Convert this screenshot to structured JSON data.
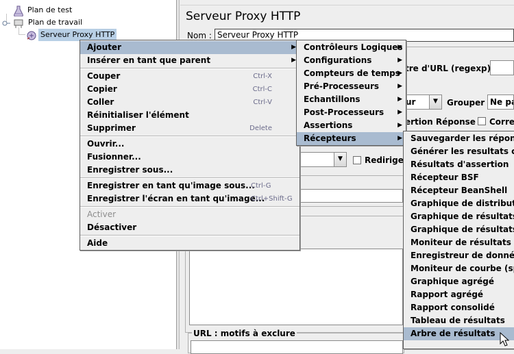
{
  "tree": {
    "items": [
      {
        "label": "Plan de test",
        "icon": "flask-icon"
      },
      {
        "label": "Plan de travail",
        "icon": "workbench-icon"
      },
      {
        "label": "Serveur Proxy HTTP",
        "icon": "proxy-icon"
      }
    ]
  },
  "panel": {
    "title": "Serveur Proxy HTTP",
    "name_label": "Nom :",
    "name_value": "Serveur Proxy HTTP",
    "url_regex_label": "tre d'URL (regexp) :",
    "group_combo_value": "ur",
    "group_label": "Grouper :",
    "group_value": "Ne pa",
    "assertion_label": "ertion Réponse",
    "corres_label": "Corre",
    "redirect_label": "Redirige",
    "exclude_label": "URL : motifs à exclure"
  },
  "context_menu": {
    "items": [
      {
        "label": "Ajouter",
        "submenu": true,
        "highlight": true
      },
      {
        "label": "Insérer en tant que parent",
        "submenu": true
      },
      {
        "sep": true
      },
      {
        "label": "Couper",
        "accel": "Ctrl-X"
      },
      {
        "label": "Copier",
        "accel": "Ctrl-C"
      },
      {
        "label": "Coller",
        "accel": "Ctrl-V"
      },
      {
        "label": "Réinitialiser l'élément"
      },
      {
        "label": "Supprimer",
        "accel": "Delete"
      },
      {
        "sep": true
      },
      {
        "label": "Ouvrir..."
      },
      {
        "label": "Fusionner..."
      },
      {
        "label": "Enregistrer sous..."
      },
      {
        "sep": true
      },
      {
        "label": "Enregistrer en tant qu'image sous...",
        "accel": "Ctrl-G"
      },
      {
        "label": "Enregistrer l'écran en tant qu'image...",
        "accel": "Ctrl+Shift-G"
      },
      {
        "sep": true
      },
      {
        "label": "Activer",
        "disabled": true
      },
      {
        "label": "Désactiver"
      },
      {
        "sep": true
      },
      {
        "label": "Aide"
      }
    ]
  },
  "submenu_add": {
    "items": [
      {
        "label": "Contrôleurs Logiques"
      },
      {
        "label": "Configurations"
      },
      {
        "label": "Compteurs de temps"
      },
      {
        "label": "Pré-Processeurs"
      },
      {
        "label": "Echantillons"
      },
      {
        "label": "Post-Processeurs"
      },
      {
        "label": "Assertions"
      },
      {
        "label": "Récepteurs",
        "highlight": true
      }
    ]
  },
  "submenu_listeners": {
    "items": [
      {
        "label": "Sauvegarder les réponses"
      },
      {
        "label": "Générer les resultats con"
      },
      {
        "label": "Résultats d'assertion"
      },
      {
        "label": "Récepteur BSF"
      },
      {
        "label": "Récepteur BeanShell"
      },
      {
        "label": "Graphique de distributio"
      },
      {
        "label": "Graphique de résultats c"
      },
      {
        "label": "Graphique de résultats"
      },
      {
        "label": "Moniteur de résultats"
      },
      {
        "label": "Enregistreur de données"
      },
      {
        "label": "Moniteur de courbe (spli"
      },
      {
        "label": "Graphique agrégé"
      },
      {
        "label": "Rapport agrégé"
      },
      {
        "label": "Rapport consolidé"
      },
      {
        "label": "Tableau de résultats"
      },
      {
        "label": "Arbre de résultats",
        "highlight": true
      }
    ]
  }
}
